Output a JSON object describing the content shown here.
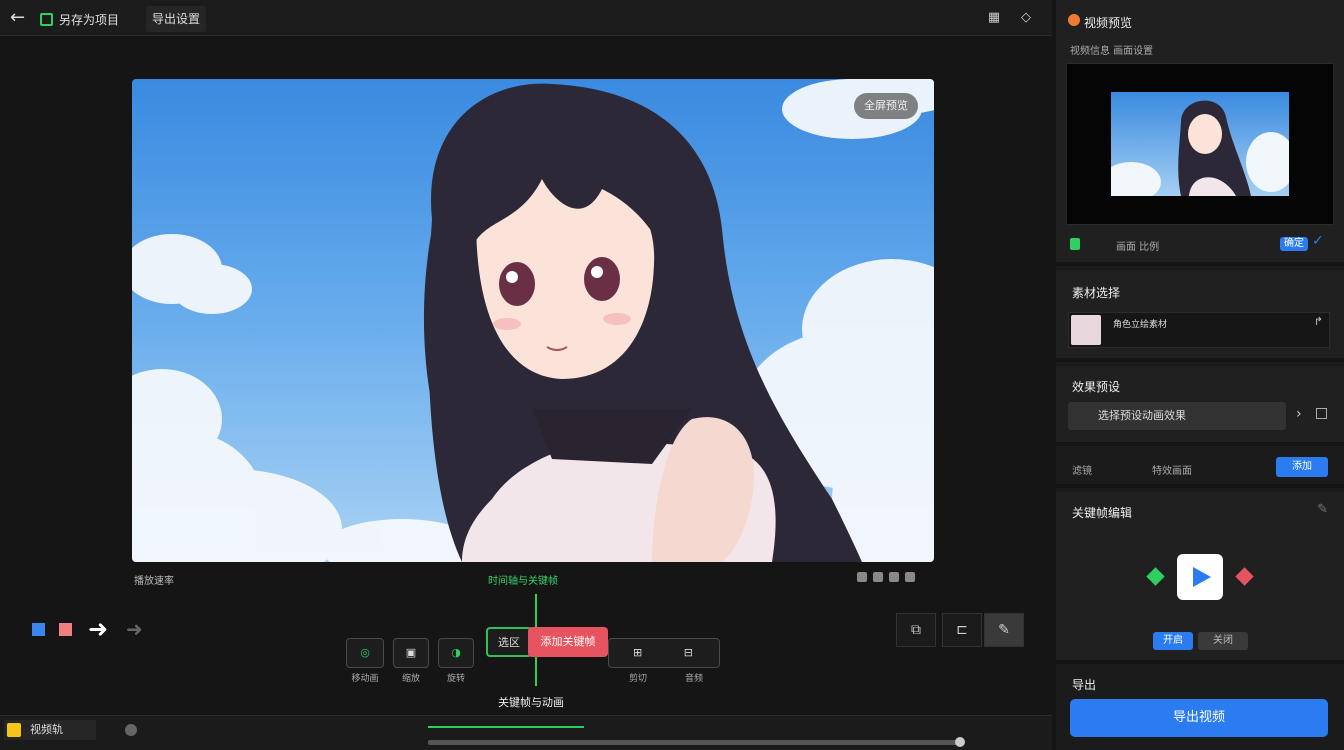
{
  "topbar": {
    "project_title": "另存为项目",
    "tab_label": "导出设置"
  },
  "preview": {
    "resolution_chip": "全屏预览",
    "below_left": "播放速率",
    "track_label": "时间轴与关键帧",
    "bottom_label": "关键帧与动画"
  },
  "controls": {
    "buttons": [
      {
        "glyph": "◎",
        "label": "移动画"
      },
      {
        "glyph": "▣",
        "label": "缩放"
      },
      {
        "glyph": "◑",
        "label": "旋转"
      },
      {
        "glyph": "⊞",
        "label": "剪切"
      },
      {
        "glyph": "⊟",
        "label": "音频"
      }
    ],
    "green_button": "选区",
    "red_button": "添加关键帧"
  },
  "timeline": {
    "chip_label": "视频轨"
  },
  "right_panel": {
    "header_title": "视频预览",
    "header_sub": "视频信息  画面设置",
    "preview_toggle_label": "画面 比例",
    "apply_label": "确定",
    "section2_title": "素材选择",
    "asset_name": "角色立绘素材",
    "section3_title": "效果预设",
    "field_text": "选择预设动画效果",
    "row_a": "滤镜",
    "row_b": "特效画面",
    "row_btn": "添加",
    "section4_title": "关键帧编辑",
    "toggle_on": "开启",
    "toggle_off": "关闭",
    "section5_title": "导出",
    "export_label": "导出视频"
  },
  "colors": {
    "accent": "#2a7cf0",
    "green": "#2bd05a",
    "red": "#e7545f"
  }
}
